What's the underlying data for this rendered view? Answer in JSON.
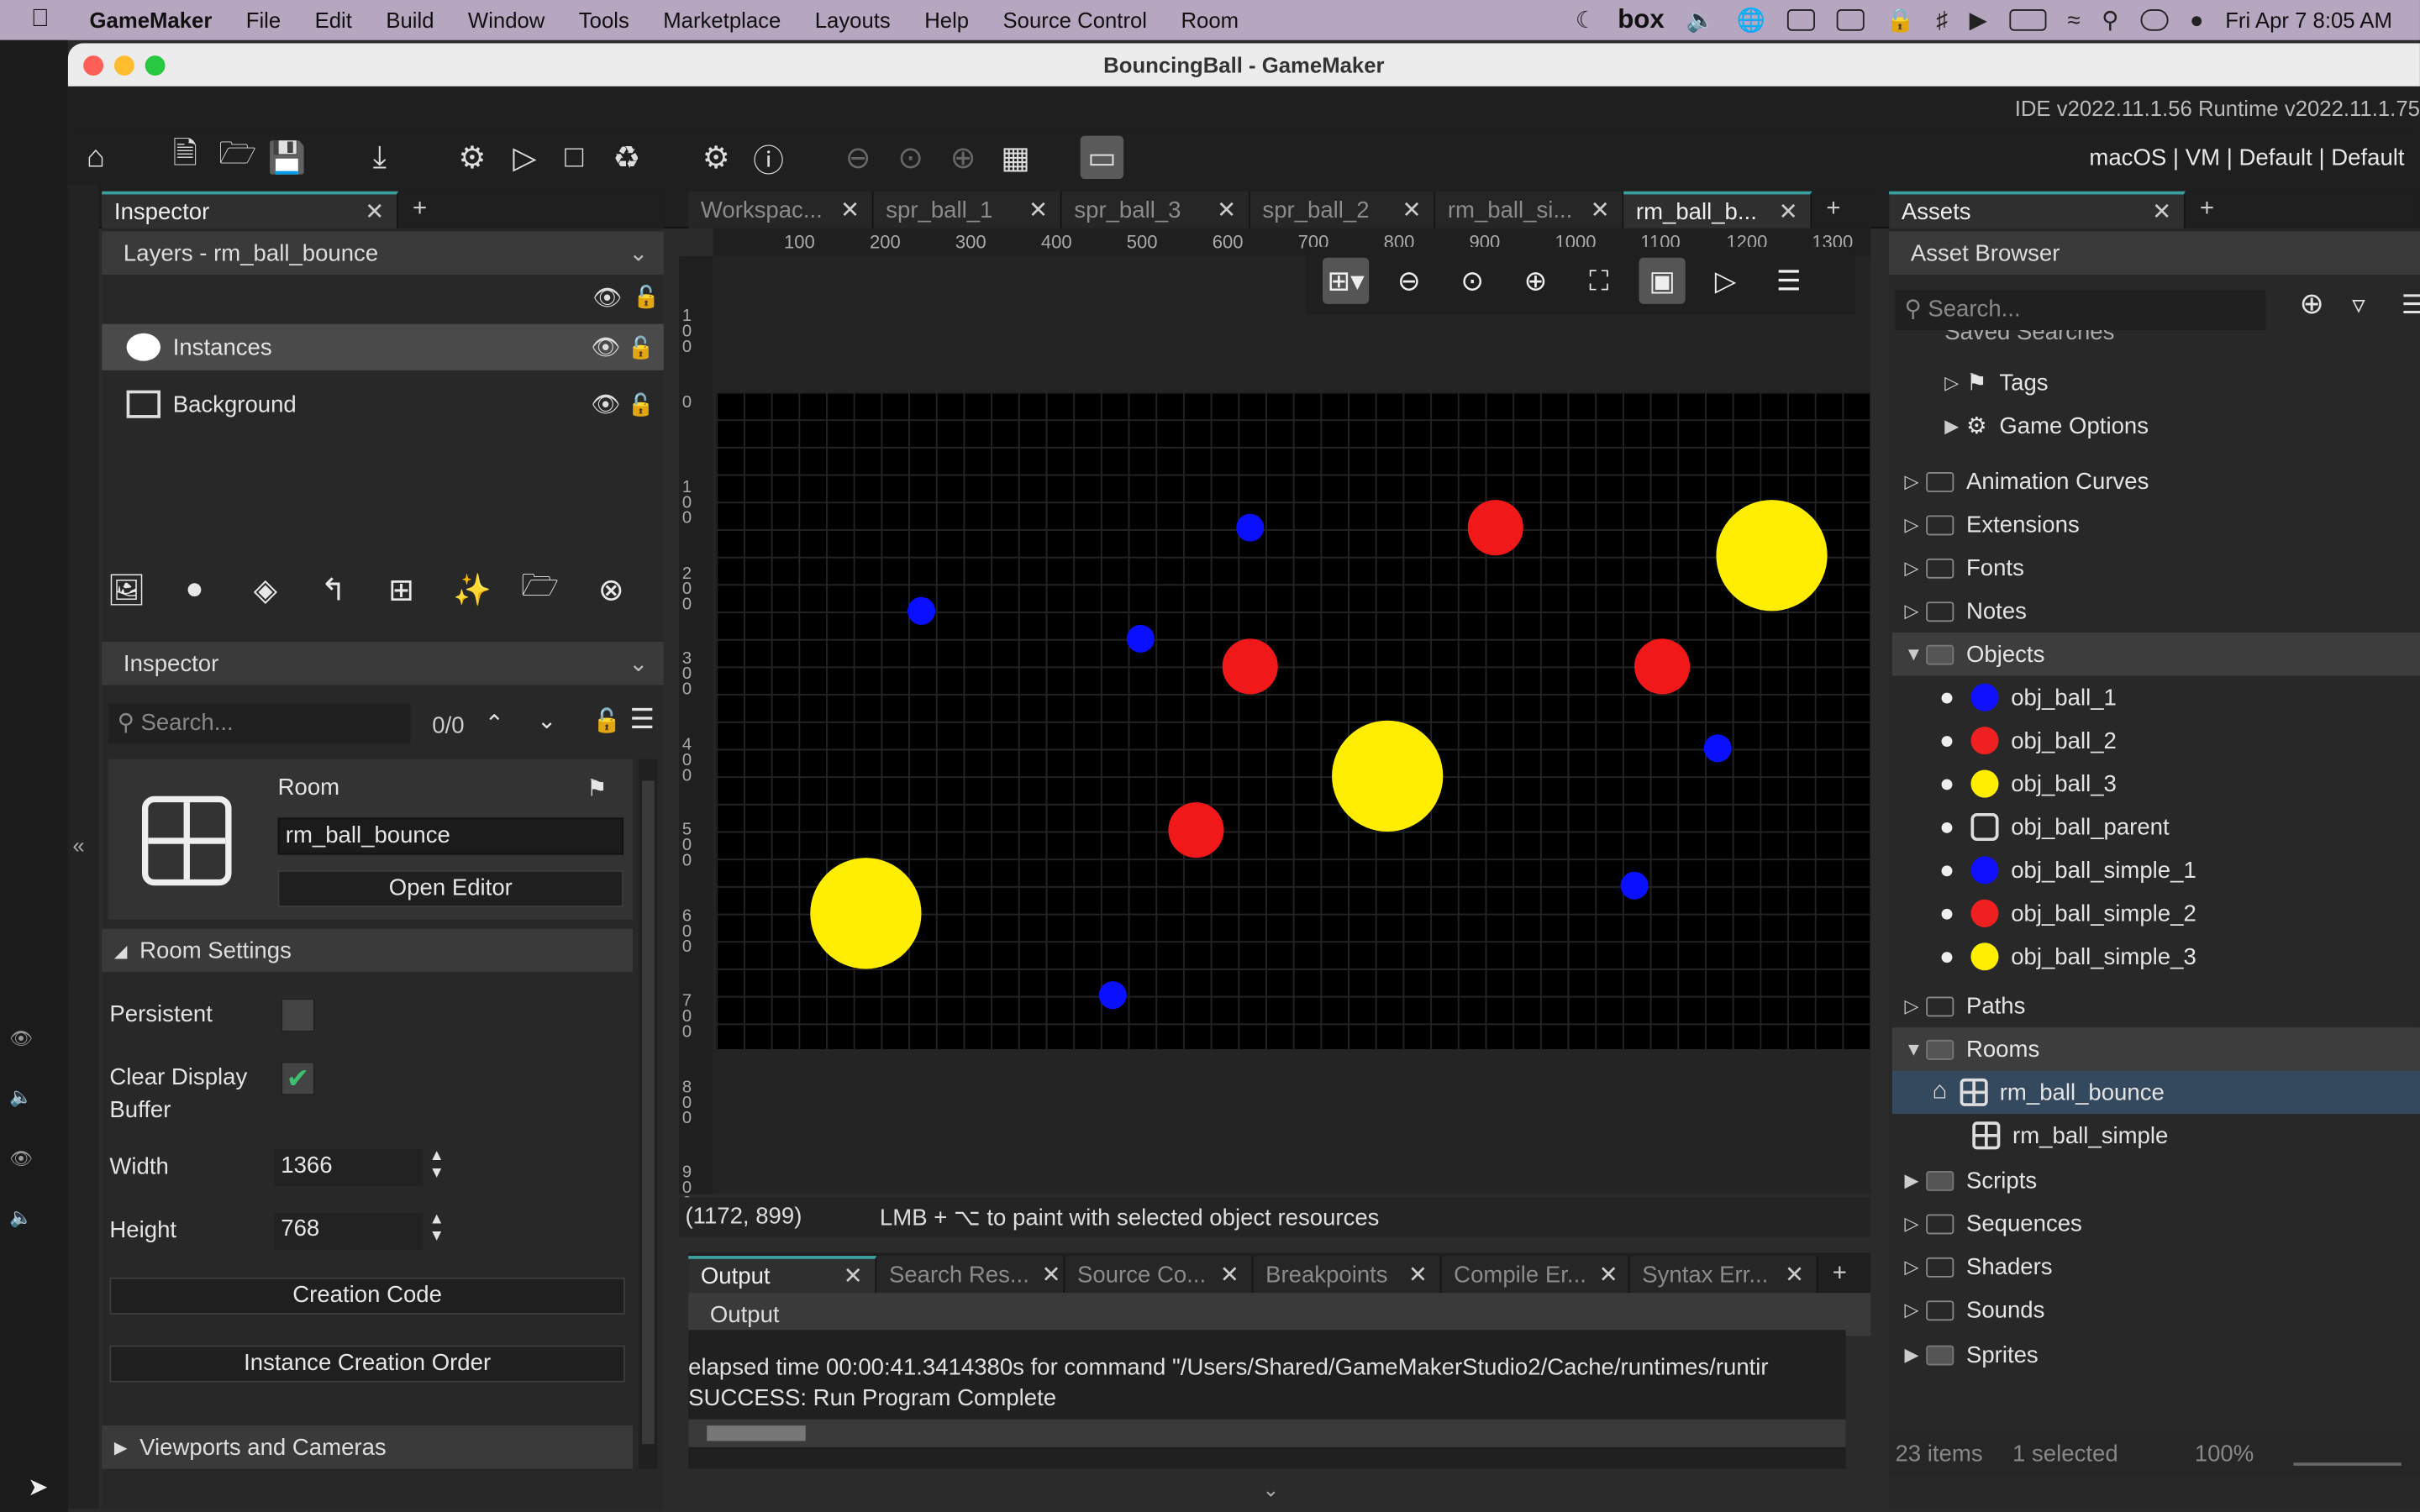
{
  "menubar": {
    "app": "GameMaker",
    "items": [
      "File",
      "Edit",
      "Build",
      "Window",
      "Tools",
      "Marketplace",
      "Layouts",
      "Help",
      "Source Control",
      "Room"
    ],
    "box_label": "box",
    "clock": "Fri Apr 7  8:05 AM"
  },
  "window": {
    "title": "BouncingBall - GameMaker",
    "version": "IDE v2022.11.1.56  Runtime v2022.11.1.75",
    "target": "macOS | VM | Default | Default"
  },
  "inspector_panel": {
    "tab": "Inspector",
    "layers_title": "Layers - rm_ball_bounce",
    "layers": [
      {
        "name": "Instances",
        "selected": true
      },
      {
        "name": "Background",
        "selected": false
      }
    ],
    "inspector_title": "Inspector",
    "search_placeholder": "Search...",
    "match_count": "0/0",
    "room_type": "Room",
    "room_name": "rm_ball_bounce",
    "open_editor": "Open Editor",
    "room_settings": "Room Settings",
    "persistent_label": "Persistent",
    "clear_display_label": "Clear Display Buffer",
    "width_label": "Width",
    "width_value": "1366",
    "height_label": "Height",
    "height_value": "768",
    "creation_code": "Creation Code",
    "instance_order": "Instance Creation Order",
    "viewports": "Viewports and Cameras"
  },
  "editor": {
    "tabs": [
      "Workspac...",
      "spr_ball_1",
      "spr_ball_3",
      "spr_ball_2",
      "rm_ball_si...",
      "rm_ball_b..."
    ],
    "active_tab": 5,
    "ruler_x": [
      "100",
      "200",
      "300",
      "400",
      "500",
      "600",
      "700",
      "800",
      "900",
      "1000",
      "1100",
      "1200",
      "1300"
    ],
    "ruler_y": [
      "100",
      "0",
      "100",
      "200",
      "300",
      "400",
      "500",
      "600",
      "700",
      "800",
      "900"
    ],
    "coords": "(1172, 899)",
    "hint": "LMB + ⌥ to paint with selected object resources",
    "balls": [
      {
        "color": "#0a10ff",
        "size": "small"
      },
      {
        "color": "#0a10ff",
        "size": "small"
      },
      {
        "color": "#0a10ff",
        "size": "small"
      },
      {
        "color": "#0a10ff",
        "size": "small"
      },
      {
        "color": "#0a10ff",
        "size": "small"
      },
      {
        "color": "#0a10ff",
        "size": "small"
      },
      {
        "color": "#f01818",
        "size": "medium"
      },
      {
        "color": "#f01818",
        "size": "medium"
      },
      {
        "color": "#f01818",
        "size": "medium"
      },
      {
        "color": "#f01818",
        "size": "medium"
      },
      {
        "color": "#ffee00",
        "size": "large"
      },
      {
        "color": "#ffee00",
        "size": "large"
      },
      {
        "color": "#ffee00",
        "size": "large"
      }
    ]
  },
  "output": {
    "tabs": [
      "Output",
      "Search Res...",
      "Source Co...",
      "Breakpoints",
      "Compile Er...",
      "Syntax Err..."
    ],
    "header": "Output",
    "lines": [
      "elapsed time 00:00:41.3414380s for command \"/Users/Shared/GameMakerStudio2/Cache/runtimes/runtir",
      "SUCCESS: Run Program Complete"
    ]
  },
  "assets": {
    "tab": "Assets",
    "title": "Asset Browser",
    "search_placeholder": "Search...",
    "clipped_row": "Saved Searches",
    "tags": "Tags",
    "game_options": "Game Options",
    "folders": [
      "Animation Curves",
      "Extensions",
      "Fonts",
      "Notes"
    ],
    "objects_folder": "Objects",
    "objects": [
      {
        "name": "obj_ball_1",
        "color": "#1010ff"
      },
      {
        "name": "obj_ball_2",
        "color": "#f02020"
      },
      {
        "name": "obj_ball_3",
        "color": "#ffee00"
      },
      {
        "name": "obj_ball_parent",
        "color": ""
      },
      {
        "name": "obj_ball_simple_1",
        "color": "#1010ff"
      },
      {
        "name": "obj_ball_simple_2",
        "color": "#f02020"
      },
      {
        "name": "obj_ball_simple_3",
        "color": "#ffee00"
      }
    ],
    "paths": "Paths",
    "rooms_folder": "Rooms",
    "rooms": [
      "rm_ball_bounce",
      "rm_ball_simple"
    ],
    "more_folders": [
      "Scripts",
      "Sequences",
      "Shaders",
      "Sounds",
      "Sprites"
    ],
    "status_count": "23 items",
    "status_selected": "1 selected",
    "zoom": "100%"
  }
}
